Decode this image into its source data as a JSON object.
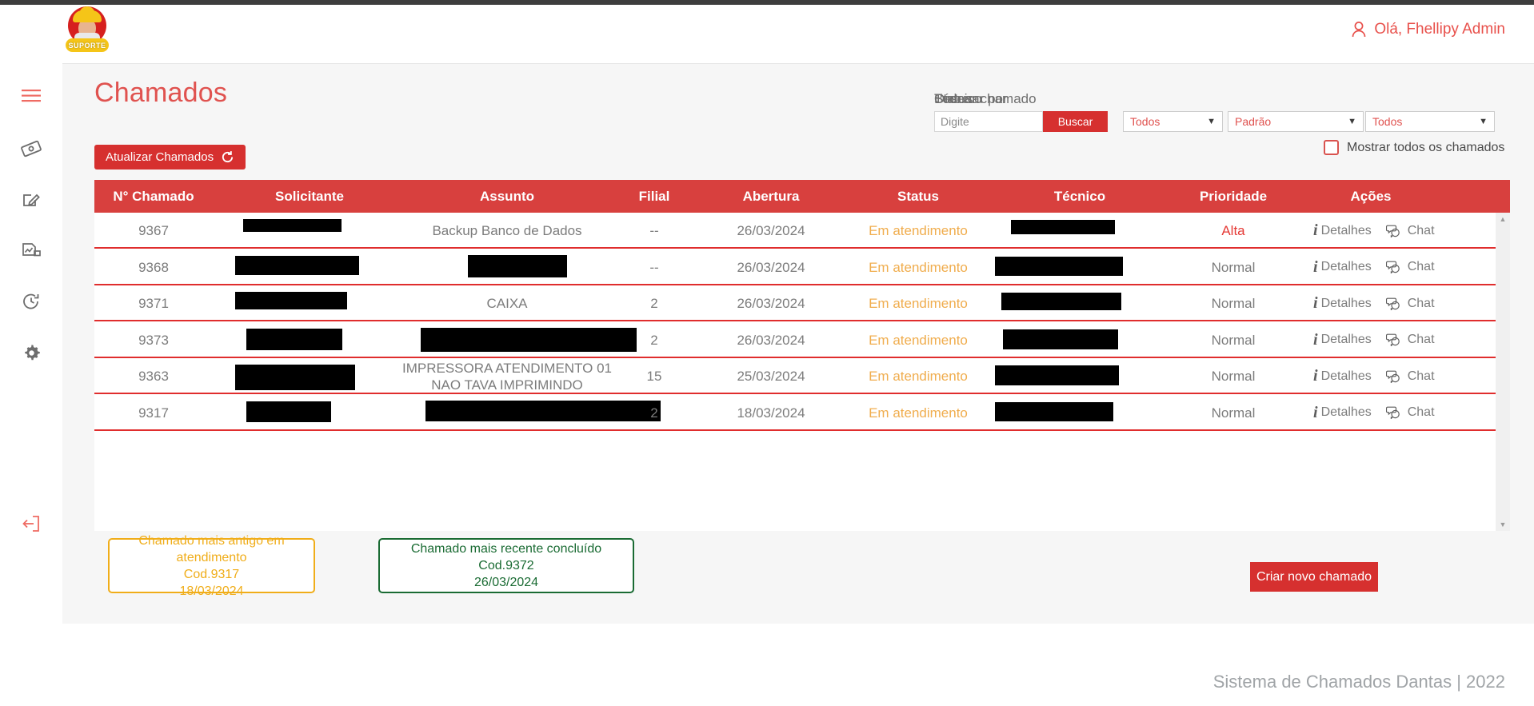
{
  "brand": {
    "logo_text": "SUPORTE",
    "accent": "#d6302f",
    "title_color": "#e0524f"
  },
  "header": {
    "user_icon": "user-icon",
    "greeting": "Olá, Fhellipy Admin"
  },
  "sidebar": {
    "items": [
      {
        "name": "menu-toggle",
        "icon": "hamburger-icon",
        "color": "#ef6b63"
      },
      {
        "name": "tickets",
        "icon": "ticket-icon",
        "color": "#6d6d6d"
      },
      {
        "name": "new-ticket",
        "icon": "pencil-square-icon",
        "color": "#6d6d6d"
      },
      {
        "name": "reports",
        "icon": "report-chart-icon",
        "color": "#6d6d6d"
      },
      {
        "name": "history",
        "icon": "clock-history-icon",
        "color": "#6d6d6d"
      },
      {
        "name": "settings",
        "icon": "gear-icon",
        "color": "#6d6d6d"
      },
      {
        "name": "logout",
        "icon": "logout-icon",
        "color": "#ef6b63"
      }
    ]
  },
  "page": {
    "title": "Chamados",
    "refresh_button": "Atualizar Chamados",
    "refresh_icon": "refresh-icon"
  },
  "filters": {
    "search_label": "Buscar chamado",
    "search_placeholder": "Digite",
    "search_value": "",
    "search_button": "Buscar",
    "status_label": "Status",
    "status_value": "Todos",
    "order_label": "Ordenar por",
    "order_value": "Padrão",
    "tech_label": "Técnico",
    "tech_value": "Todos",
    "show_all_label": "Mostrar todos os chamados",
    "show_all_checked": false
  },
  "table": {
    "columns": [
      "N° Chamado",
      "Solicitante",
      "Assunto",
      "Filial",
      "Abertura",
      "Status",
      "Técnico",
      "Prioridade",
      "Ações"
    ],
    "action_details": "Detalhes",
    "action_chat": "Chat",
    "details_icon": "info-icon",
    "chat_icon": "chat-bubbles-icon",
    "rows": [
      {
        "numero": "9367",
        "solicitante": "",
        "solicitante_redacted": true,
        "assunto": "Backup Banco de Dados",
        "assunto_redacted": false,
        "filial": "--",
        "abertura": "26/03/2024",
        "status": "Em atendimento",
        "tecnico": "",
        "tecnico_redacted": true,
        "prioridade": "Alta"
      },
      {
        "numero": "9368",
        "solicitante": "",
        "solicitante_redacted": true,
        "assunto": "",
        "assunto_redacted": true,
        "filial": "--",
        "abertura": "26/03/2024",
        "status": "Em atendimento",
        "tecnico": "",
        "tecnico_redacted": true,
        "prioridade": "Normal"
      },
      {
        "numero": "9371",
        "solicitante": "",
        "solicitante_redacted": true,
        "assunto": "CAIXA",
        "assunto_redacted": false,
        "filial": "2",
        "abertura": "26/03/2024",
        "status": "Em atendimento",
        "tecnico": "",
        "tecnico_redacted": true,
        "prioridade": "Normal"
      },
      {
        "numero": "9373",
        "solicitante": "",
        "solicitante_redacted": true,
        "assunto": "",
        "assunto_redacted": true,
        "filial": "2",
        "abertura": "26/03/2024",
        "status": "Em atendimento",
        "tecnico": "",
        "tecnico_redacted": true,
        "prioridade": "Normal"
      },
      {
        "numero": "9363",
        "solicitante": "",
        "solicitante_redacted": true,
        "assunto": "IMPRESSORA ATENDIMENTO 01 NAO TAVA IMPRIMINDO",
        "assunto_redacted": false,
        "filial": "15",
        "abertura": "25/03/2024",
        "status": "Em atendimento",
        "tecnico": "",
        "tecnico_redacted": true,
        "prioridade": "Normal"
      },
      {
        "numero": "9317",
        "solicitante": "",
        "solicitante_redacted": true,
        "assunto": "",
        "assunto_redacted": true,
        "filial": "2",
        "abertura": "18/03/2024",
        "status": "Em atendimento",
        "tecnico": "",
        "tecnico_redacted": true,
        "prioridade": "Normal"
      }
    ]
  },
  "cards": {
    "oldest": {
      "line1": "Chamado mais antigo em",
      "line2": "atendimento",
      "line3": "Cod.9317",
      "line4": "18/03/2024",
      "color": "#f0ad19"
    },
    "recent": {
      "line1": "Chamado mais recente concluído",
      "line2": "Cod.9372",
      "line3": "26/03/2024",
      "color": "#1a6b33"
    }
  },
  "actions": {
    "create_ticket": "Criar novo chamado"
  },
  "footer": {
    "text": "Sistema de Chamados Dantas | 2022"
  }
}
